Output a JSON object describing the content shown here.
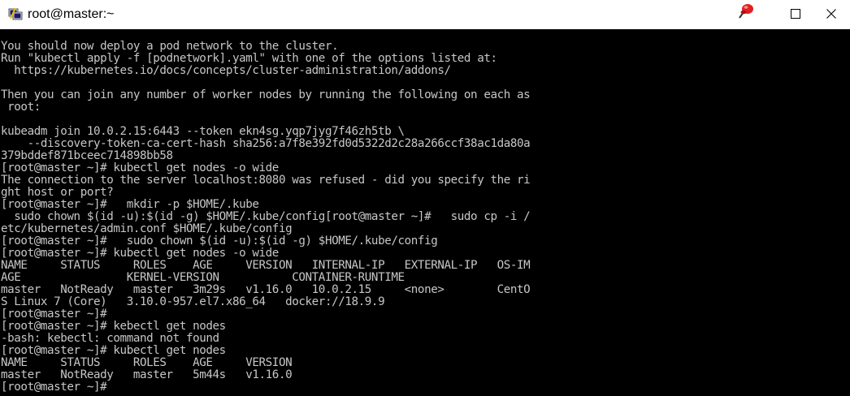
{
  "window": {
    "title": "root@master:~",
    "icon_name": "putty-terminal-icon",
    "pin_icon": "red-pin-icon",
    "maximize_icon": "maximize-icon",
    "close_icon": "close-icon"
  },
  "colors": {
    "terminal_bg": "#000000",
    "terminal_fg": "#c7c7c7",
    "titlebar_bg": "#ffffff"
  },
  "terminal": {
    "lines": [
      "You should now deploy a pod network to the cluster.",
      "Run \"kubectl apply -f [podnetwork].yaml\" with one of the options listed at:",
      "  https://kubernetes.io/docs/concepts/cluster-administration/addons/",
      "",
      "Then you can join any number of worker nodes by running the following on each as",
      " root:",
      "",
      "kubeadm join 10.0.2.15:6443 --token ekn4sg.yqp7jyg7f46zh5tb \\",
      "    --discovery-token-ca-cert-hash sha256:a7f8e392fd0d5322d2c28a266ccf38ac1da80a",
      "379bddef871bceec714898bb58",
      "[root@master ~]# kubectl get nodes -o wide",
      "The connection to the server localhost:8080 was refused - did you specify the ri",
      "ght host or port?",
      "[root@master ~]#   mkdir -p $HOME/.kube",
      "  sudo chown $(id -u):$(id -g) $HOME/.kube/config[root@master ~]#   sudo cp -i /",
      "etc/kubernetes/admin.conf $HOME/.kube/config",
      "[root@master ~]#   sudo chown $(id -u):$(id -g) $HOME/.kube/config",
      "[root@master ~]# kubectl get nodes -o wide",
      "NAME     STATUS     ROLES    AGE     VERSION   INTERNAL-IP   EXTERNAL-IP   OS-IM",
      "AGE                KERNEL-VERSION           CONTAINER-RUNTIME",
      "master   NotReady   master   3m29s   v1.16.0   10.0.2.15     <none>        CentO",
      "S Linux 7 (Core)   3.10.0-957.el7.x86_64   docker://18.9.9",
      "[root@master ~]#",
      "[root@master ~]# kebectl get nodes",
      "-bash: kebectl: command not found",
      "[root@master ~]# kubectl get nodes",
      "NAME     STATUS     ROLES    AGE     VERSION",
      "master   NotReady   master   5m44s   v1.16.0",
      "[root@master ~]#"
    ]
  }
}
